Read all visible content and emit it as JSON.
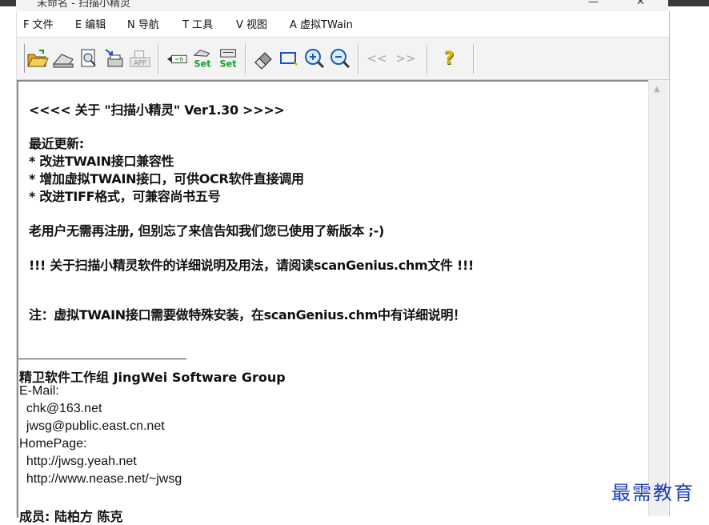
{
  "titlebar": {
    "title": "未命名 - 扫描小精灵",
    "minimize": "—",
    "close": "✕"
  },
  "menu": [
    {
      "label": "F 文件"
    },
    {
      "label": "E 编辑"
    },
    {
      "label": "N 导航"
    },
    {
      "label": "T 工具"
    },
    {
      "label": "V 视图"
    },
    {
      "label": "A 虚拟TWain"
    }
  ],
  "toolbar": {
    "buttons": [
      {
        "icon": "open-folder-icon"
      },
      {
        "icon": "scanner-icon"
      },
      {
        "icon": "preview-icon"
      },
      {
        "icon": "acquire-icon"
      },
      {
        "icon": "app-icon",
        "label": "APP"
      },
      {
        "icon": "select-source-icon"
      },
      {
        "icon": "scan-set-icon",
        "label": "Set"
      },
      {
        "icon": "scan-settings-icon",
        "label": "Set"
      },
      {
        "icon": "eraser-icon"
      },
      {
        "icon": "select-rect-icon"
      },
      {
        "icon": "zoom-in-icon"
      },
      {
        "icon": "zoom-out-icon"
      },
      {
        "icon": "prev-icon",
        "label": "<<"
      },
      {
        "icon": "next-icon",
        "label": ">>"
      },
      {
        "icon": "help-icon",
        "label": "?"
      }
    ]
  },
  "content": {
    "lines": [
      "<<<< 关于 \"扫描小精灵\" Ver1.30 >>>>",
      "最近更新:",
      "* 改进TWAIN接口兼容性",
      "* 增加虚拟TWAIN接口，可供OCR软件直接调用",
      "* 改进TIFF格式，可兼容尚书五号",
      "老用户无需再注册, 但别忘了来信告知我们您已使用了新版本 ;-)",
      "!!! 关于扫描小精灵软件的详细说明及用法，请阅读scanGenius.chm文件 !!!",
      "注：虚拟TWAIN接口需要做特殊安装，在scanGenius.chm中有详细说明！"
    ],
    "signature": {
      "group": "精卫软件工作组  JingWei Software Group",
      "email_label": "E-Mail:",
      "email1": "  chk@163.net",
      "email2": "  jwsg@public.east.cn.net",
      "homepage_label": "HomePage:",
      "url1": "  http://jwsg.yeah.net",
      "url2": "  http://www.nease.net/~jwsg",
      "members": "成员: 陆柏方  陈克"
    }
  },
  "watermark": "最需教育",
  "colors": {
    "watermark": "#1a3fb5",
    "toolbar_bg": "#f3f3f3"
  }
}
